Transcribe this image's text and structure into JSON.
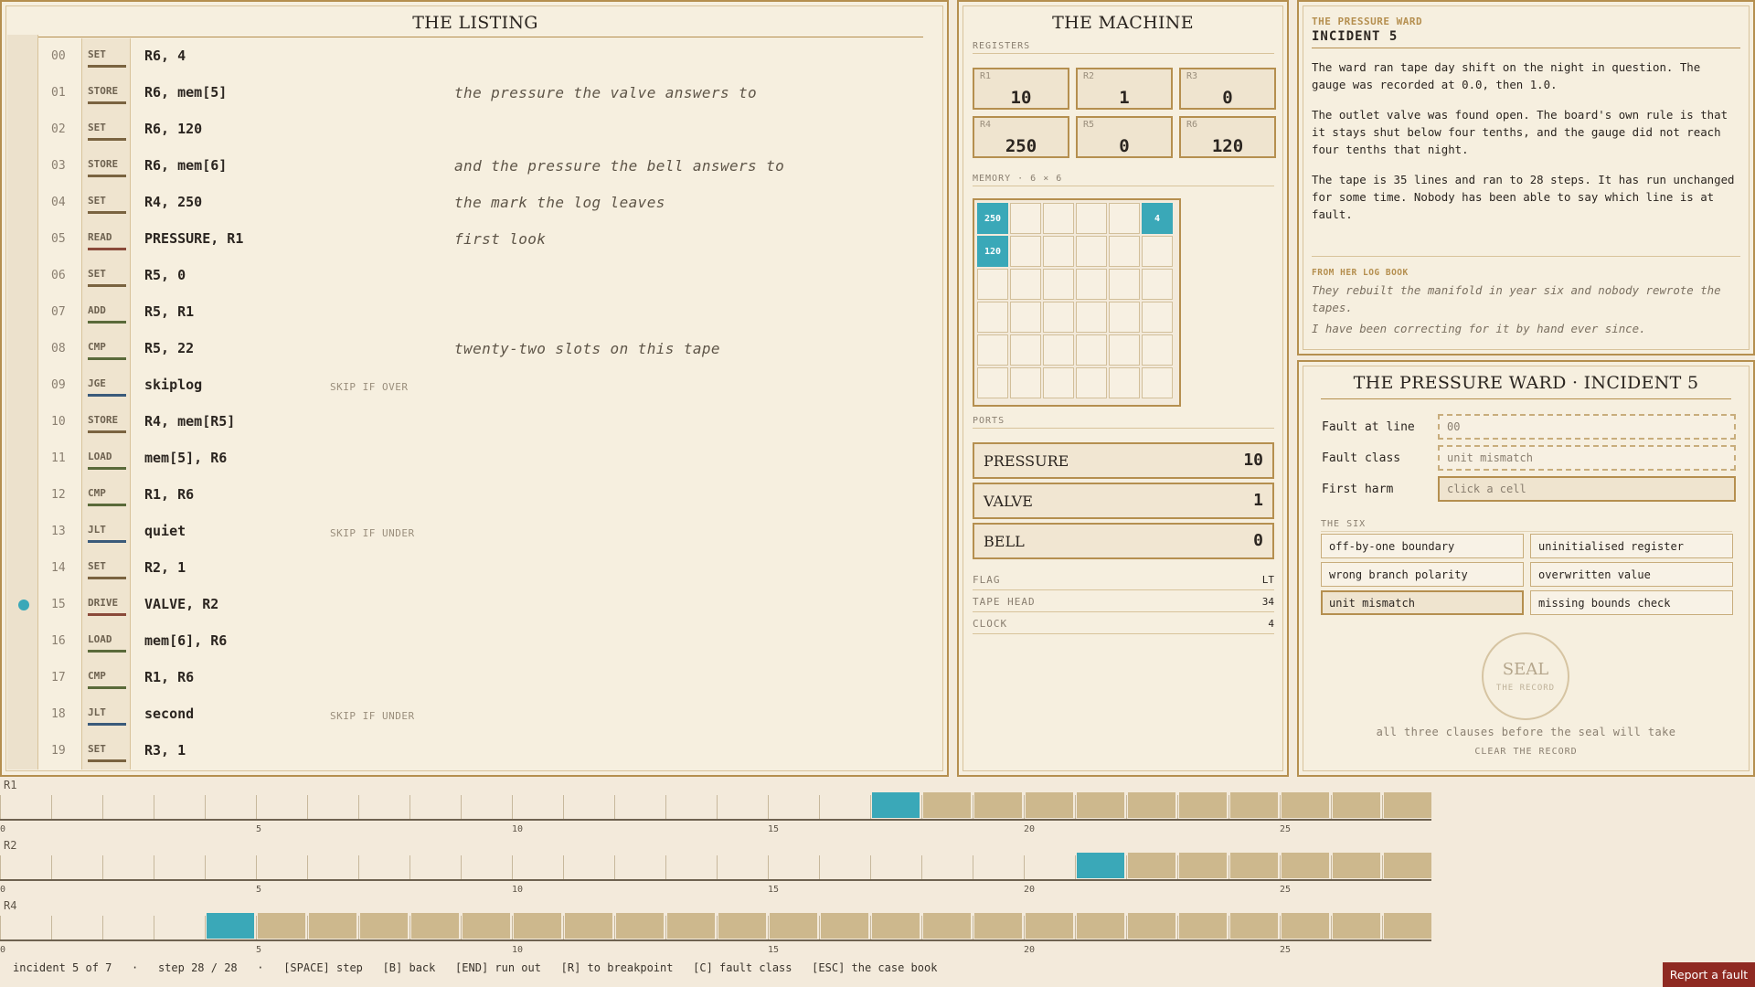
{
  "colors": {
    "accent": "#3aa8b8",
    "frame": "#b58f4f",
    "report": "#8f2a22"
  },
  "listing": {
    "title": "THE LISTING",
    "rows": [
      {
        "num": "00",
        "op": "SET",
        "args": "R6, 4",
        "hint": "",
        "comment": "",
        "bp": false
      },
      {
        "num": "01",
        "op": "STORE",
        "args": "R6, mem[5]",
        "hint": "",
        "comment": "the pressure the valve answers to",
        "bp": false
      },
      {
        "num": "02",
        "op": "SET",
        "args": "R6, 120",
        "hint": "",
        "comment": "",
        "bp": false
      },
      {
        "num": "03",
        "op": "STORE",
        "args": "R6, mem[6]",
        "hint": "",
        "comment": "and the pressure the bell answers to",
        "bp": false
      },
      {
        "num": "04",
        "op": "SET",
        "args": "R4, 250",
        "hint": "",
        "comment": "the mark the log leaves",
        "bp": false
      },
      {
        "num": "05",
        "op": "READ",
        "args": "PRESSURE, R1",
        "hint": "",
        "comment": "first look",
        "bp": false
      },
      {
        "num": "06",
        "op": "SET",
        "args": "R5, 0",
        "hint": "",
        "comment": "",
        "bp": false
      },
      {
        "num": "07",
        "op": "ADD",
        "args": "R5, R1",
        "hint": "",
        "comment": "",
        "bp": false
      },
      {
        "num": "08",
        "op": "CMP",
        "args": "R5, 22",
        "hint": "",
        "comment": "twenty-two slots on this tape",
        "bp": false
      },
      {
        "num": "09",
        "op": "JGE",
        "args": "skiplog",
        "hint": "SKIP IF OVER",
        "comment": "",
        "bp": false
      },
      {
        "num": "10",
        "op": "STORE",
        "args": "R4, mem[R5]",
        "hint": "",
        "comment": "",
        "bp": false
      },
      {
        "num": "11",
        "op": "LOAD",
        "args": "mem[5], R6",
        "hint": "",
        "comment": "",
        "bp": false
      },
      {
        "num": "12",
        "op": "CMP",
        "args": "R1, R6",
        "hint": "",
        "comment": "",
        "bp": false
      },
      {
        "num": "13",
        "op": "JLT",
        "args": "quiet",
        "hint": "SKIP IF UNDER",
        "comment": "",
        "bp": false
      },
      {
        "num": "14",
        "op": "SET",
        "args": "R2, 1",
        "hint": "",
        "comment": "",
        "bp": false
      },
      {
        "num": "15",
        "op": "DRIVE",
        "args": "VALVE, R2",
        "hint": "",
        "comment": "",
        "bp": true
      },
      {
        "num": "16",
        "op": "LOAD",
        "args": "mem[6], R6",
        "hint": "",
        "comment": "",
        "bp": false
      },
      {
        "num": "17",
        "op": "CMP",
        "args": "R1, R6",
        "hint": "",
        "comment": "",
        "bp": false
      },
      {
        "num": "18",
        "op": "JLT",
        "args": "second",
        "hint": "SKIP IF UNDER",
        "comment": "",
        "bp": false
      },
      {
        "num": "19",
        "op": "SET",
        "args": "R3, 1",
        "hint": "",
        "comment": "",
        "bp": false
      }
    ]
  },
  "machine": {
    "title": "THE MACHINE",
    "registers_label": "REGISTERS",
    "registers": [
      {
        "name": "R1",
        "value": "10"
      },
      {
        "name": "R2",
        "value": "1"
      },
      {
        "name": "R3",
        "value": "0"
      },
      {
        "name": "R4",
        "value": "250"
      },
      {
        "name": "R5",
        "value": "0"
      },
      {
        "name": "R6",
        "value": "120"
      }
    ],
    "memory_label": "MEMORY · 6 × 6",
    "memory": [
      [
        "250",
        "",
        "",
        "",
        "",
        "4"
      ],
      [
        "120",
        "",
        "",
        "",
        "",
        ""
      ],
      [
        "",
        "",
        "",
        "",
        "",
        ""
      ],
      [
        "",
        "",
        "",
        "",
        "",
        ""
      ],
      [
        "",
        "",
        "",
        "",
        "",
        ""
      ],
      [
        "",
        "",
        "",
        "",
        "",
        ""
      ]
    ],
    "ports_label": "PORTS",
    "ports": [
      {
        "name": "PRESSURE",
        "value": "10"
      },
      {
        "name": "VALVE",
        "value": "1"
      },
      {
        "name": "BELL",
        "value": "0"
      }
    ],
    "stats": [
      {
        "label": "FLAG",
        "value": "LT"
      },
      {
        "label": "TAPE HEAD",
        "value": "34"
      },
      {
        "label": "CLOCK",
        "value": "4"
      }
    ]
  },
  "incident": {
    "eyebrow": "THE PRESSURE WARD",
    "title": "INCIDENT 5",
    "paragraphs": [
      "The ward ran tape day shift on the night in question. The gauge was recorded at 0.0, then 1.0.",
      "The outlet valve was found open. The board's own rule is that it stays shut below four tenths, and the gauge did not reach four tenths that night.",
      "The tape is 35 lines and ran to 28 steps. It has run unchanged for some time. Nobody has been able to say which line is at fault."
    ],
    "log_label": "FROM HER LOG BOOK",
    "log_lines": [
      "They rebuilt the manifold in year six and nobody rewrote the tapes.",
      "I have been correcting for it by hand ever since."
    ]
  },
  "form": {
    "title": "THE PRESSURE WARD · INCIDENT 5",
    "fields": [
      {
        "label": "Fault at line",
        "placeholder": "00"
      },
      {
        "label": "Fault class",
        "placeholder": "unit mismatch"
      },
      {
        "label": "First harm",
        "placeholder": "click a cell"
      }
    ],
    "six_label": "THE SIX",
    "six": [
      {
        "label": "off-by-one boundary",
        "selected": false
      },
      {
        "label": "uninitialised register",
        "selected": false
      },
      {
        "label": "wrong branch polarity",
        "selected": false
      },
      {
        "label": "overwritten value",
        "selected": false
      },
      {
        "label": "unit mismatch",
        "selected": true
      },
      {
        "label": "missing bounds check",
        "selected": false
      }
    ],
    "seal_label": "SEAL",
    "seal_sub": "THE RECORD",
    "seal_note": "all three clauses before the seal will take",
    "clear_label": "CLEAR THE RECORD"
  },
  "traces": {
    "steps": 28,
    "axis_ticks": [
      "0",
      "5",
      "10",
      "15",
      "20",
      "25"
    ],
    "tracks": [
      {
        "name": "R1",
        "start": 17
      },
      {
        "name": "R2",
        "start": 21
      },
      {
        "name": "R4",
        "start": 4
      }
    ]
  },
  "status": {
    "text": "incident 5 of 7   ·   step 28 / 28   ·   [SPACE] step   [B] back   [END] run out   [R] to breakpoint   [C] fault class   [ESC] the case book",
    "report_label": "Report a fault"
  }
}
